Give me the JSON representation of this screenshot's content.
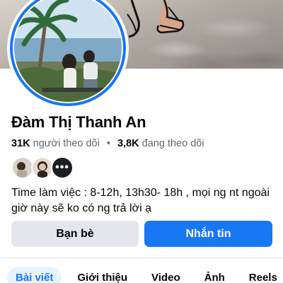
{
  "profile": {
    "name": "Đàm Thị Thanh An",
    "followers_count": "31K",
    "followers_label": "người theo dõi",
    "following_count": "3,8K",
    "following_label": "đang theo dõi",
    "separator": "•",
    "bio": "Time làm việc : 8-12h, 13h30- 18h , mọi ng nt ngoài giờ này sẽ ko có ng trả lời ạ"
  },
  "mutual_friends": {
    "more_icon": "more-dots-icon",
    "more_label": "•••"
  },
  "actions": {
    "friends_label": "Bạn bè",
    "message_label": "Nhắn tin"
  },
  "tabs": [
    {
      "label": "Bài viết",
      "active": true
    },
    {
      "label": "Giới thiệu",
      "active": false
    },
    {
      "label": "Video",
      "active": false
    },
    {
      "label": "Ảnh",
      "active": false
    },
    {
      "label": "Reels",
      "active": false
    }
  ],
  "colors": {
    "accent": "#1877f2",
    "secondary_button": "#e4e6eb",
    "active_tab_bg": "#e7f3ff",
    "muted_text": "#65676b"
  }
}
